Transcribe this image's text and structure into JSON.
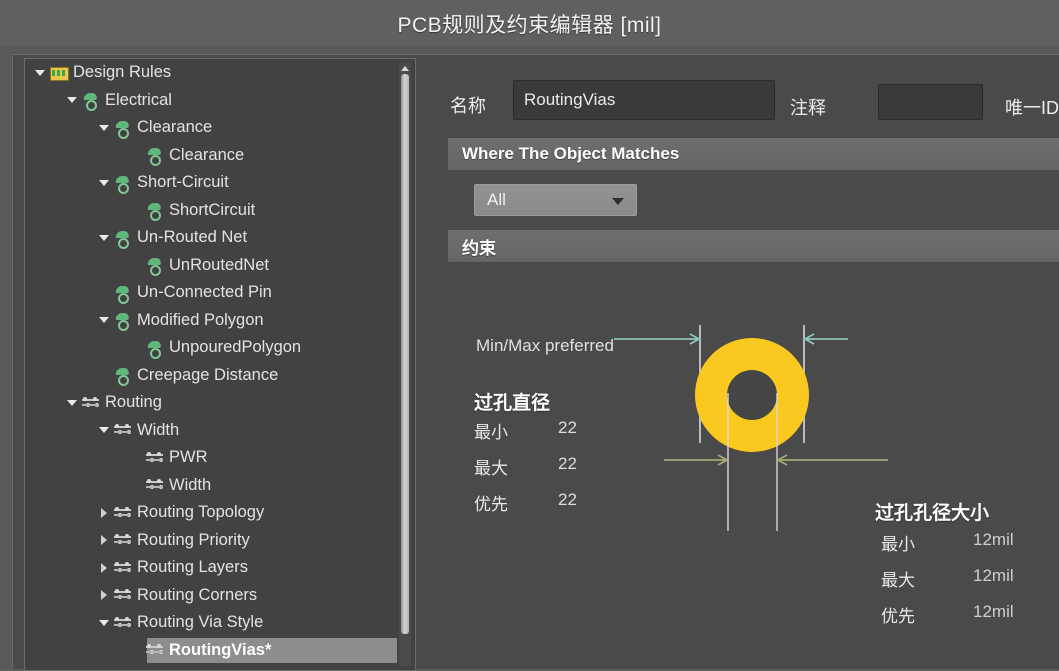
{
  "window": {
    "title": "PCB规则及约束编辑器 [mil]"
  },
  "tree": {
    "root_label": "Design Rules",
    "items": [
      {
        "label": "Design Rules",
        "depth": 0,
        "twisty": "down",
        "icon": "folder-icon",
        "selected": false
      },
      {
        "label": "Electrical",
        "depth": 1,
        "twisty": "down",
        "icon": "electrical-rule-icon",
        "selected": false
      },
      {
        "label": "Clearance",
        "depth": 2,
        "twisty": "down",
        "icon": "electrical-rule-icon",
        "selected": false
      },
      {
        "label": "Clearance",
        "depth": 3,
        "twisty": "none",
        "icon": "electrical-rule-icon",
        "selected": false
      },
      {
        "label": "Short-Circuit",
        "depth": 2,
        "twisty": "down",
        "icon": "electrical-rule-icon",
        "selected": false
      },
      {
        "label": "ShortCircuit",
        "depth": 3,
        "twisty": "none",
        "icon": "electrical-rule-icon",
        "selected": false
      },
      {
        "label": "Un-Routed Net",
        "depth": 2,
        "twisty": "down",
        "icon": "electrical-rule-icon",
        "selected": false
      },
      {
        "label": "UnRoutedNet",
        "depth": 3,
        "twisty": "none",
        "icon": "electrical-rule-icon",
        "selected": false
      },
      {
        "label": "Un-Connected Pin",
        "depth": 2,
        "twisty": "none",
        "icon": "electrical-rule-icon",
        "selected": false
      },
      {
        "label": "Modified Polygon",
        "depth": 2,
        "twisty": "down",
        "icon": "electrical-rule-icon",
        "selected": false
      },
      {
        "label": "UnpouredPolygon",
        "depth": 3,
        "twisty": "none",
        "icon": "electrical-rule-icon",
        "selected": false
      },
      {
        "label": "Creepage Distance",
        "depth": 2,
        "twisty": "none",
        "icon": "electrical-rule-icon",
        "selected": false
      },
      {
        "label": "Routing",
        "depth": 1,
        "twisty": "down",
        "icon": "routing-rule-icon",
        "selected": false
      },
      {
        "label": "Width",
        "depth": 2,
        "twisty": "down",
        "icon": "routing-rule-icon",
        "selected": false
      },
      {
        "label": "PWR",
        "depth": 3,
        "twisty": "none",
        "icon": "routing-rule-icon",
        "selected": false
      },
      {
        "label": "Width",
        "depth": 3,
        "twisty": "none",
        "icon": "routing-rule-icon",
        "selected": false
      },
      {
        "label": "Routing Topology",
        "depth": 2,
        "twisty": "right",
        "icon": "routing-rule-icon",
        "selected": false
      },
      {
        "label": "Routing Priority",
        "depth": 2,
        "twisty": "right",
        "icon": "routing-rule-icon",
        "selected": false
      },
      {
        "label": "Routing Layers",
        "depth": 2,
        "twisty": "right",
        "icon": "routing-rule-icon",
        "selected": false
      },
      {
        "label": "Routing Corners",
        "depth": 2,
        "twisty": "right",
        "icon": "routing-rule-icon",
        "selected": false
      },
      {
        "label": "Routing Via Style",
        "depth": 2,
        "twisty": "down",
        "icon": "routing-rule-icon",
        "selected": false
      },
      {
        "label": "RoutingVias*",
        "depth": 3,
        "twisty": "none",
        "icon": "routing-rule-icon",
        "selected": true
      }
    ],
    "scrollbar": {
      "up_arrow": "scroll-up-icon"
    }
  },
  "editor": {
    "name_label": "名称",
    "name_value": "RoutingVias",
    "comment_label": "注释",
    "comment_value": "",
    "unique_id_label": "唯一ID",
    "where_section_title": "Where The Object Matches",
    "scope_value": "All",
    "constraint_section_title": "约束",
    "minmax_label": "Min/Max preferred",
    "via_diameter": {
      "title": "过孔直径",
      "rows": [
        {
          "label": "最小",
          "value": "22"
        },
        {
          "label": "最大",
          "value": "22"
        },
        {
          "label": "优先",
          "value": "22"
        }
      ]
    },
    "via_hole_size": {
      "title": "过孔孔径大小",
      "rows": [
        {
          "label": "最小",
          "value": "12mil"
        },
        {
          "label": "最大",
          "value": "12mil"
        },
        {
          "label": "优先",
          "value": "12mil"
        }
      ]
    }
  },
  "colors": {
    "window_bg": "#595959",
    "panel_bg": "#4a4a4a",
    "tree_bg": "#424242",
    "section_bar": "#6e6e6e",
    "selection": "#8d8d8d",
    "via_pad": "#fac81e",
    "via_hole": "#454545",
    "arrow_teal": "#8fc4bb",
    "arrow_olive": "#a9a878",
    "text": "#e8e8e8"
  }
}
